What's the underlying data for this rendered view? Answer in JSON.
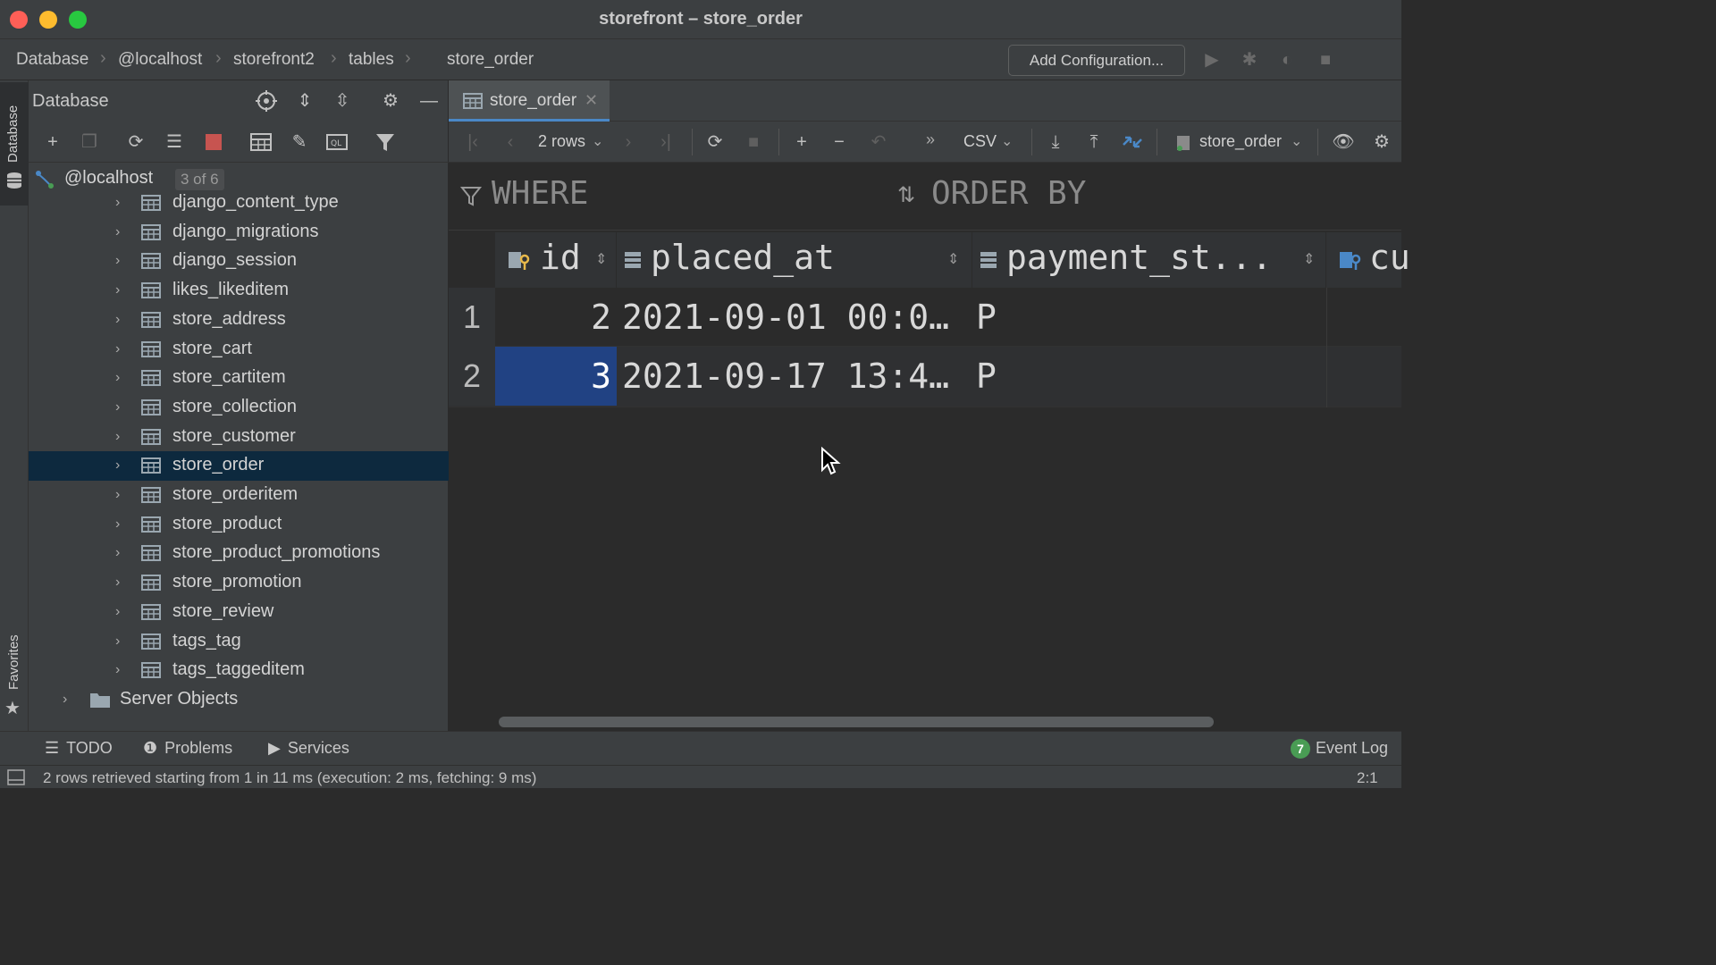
{
  "window": {
    "title": "storefront – store_order"
  },
  "breadcrumb": [
    "Database",
    "@localhost",
    "storefront2",
    "tables",
    "store_order"
  ],
  "navbar": {
    "add_configuration": "Add Configuration..."
  },
  "left_strip": {
    "database_tab": "Database",
    "favorites_tab": "Favorites"
  },
  "database_panel": {
    "title": "Database",
    "root": {
      "label": "@localhost",
      "badge": "3 of 6"
    },
    "tables": [
      "django_content_type",
      "django_migrations",
      "django_session",
      "likes_likeditem",
      "store_address",
      "store_cart",
      "store_cartitem",
      "store_collection",
      "store_customer",
      "store_order",
      "store_orderitem",
      "store_product",
      "store_product_promotions",
      "store_promotion",
      "store_review",
      "tags_tag",
      "tags_taggeditem"
    ],
    "selected_table": "store_order",
    "server_objects": "Server Objects"
  },
  "editor": {
    "tab_label": "store_order",
    "toolbar": {
      "rows": "2 rows",
      "more": "»",
      "format": "CSV",
      "source": "store_order"
    },
    "filter": {
      "where": "WHERE",
      "order_by": "ORDER BY"
    },
    "columns": [
      "id",
      "placed_at",
      "payment_st...",
      "cu"
    ],
    "rows": [
      {
        "num": "1",
        "id": "2",
        "placed_at": "2021-09-01 00:0…",
        "payment_status": "P"
      },
      {
        "num": "2",
        "id": "3",
        "placed_at": "2021-09-17 13:4…",
        "payment_status": "P"
      }
    ]
  },
  "bottom_tabs": {
    "todo": "TODO",
    "problems": "Problems",
    "services": "Services",
    "event_log_count": "7",
    "event_log": "Event Log"
  },
  "status": {
    "message": "2 rows retrieved starting from 1 in 11 ms (execution: 2 ms, fetching: 9 ms)",
    "position": "2:1"
  },
  "colors": {
    "accent": "#4a88c7",
    "selection_row": "#0d293e",
    "selected_cell": "#214283",
    "stop_red": "#c75450",
    "event_green": "#499c54"
  }
}
